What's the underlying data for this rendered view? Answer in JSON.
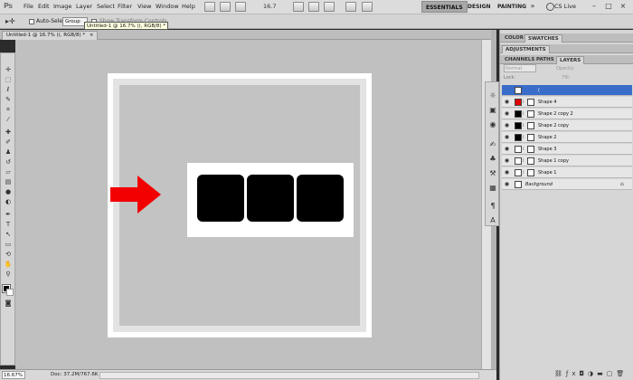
{
  "app": {
    "logo": "Ps",
    "menu": [
      "File",
      "Edit",
      "Image",
      "Layer",
      "Select",
      "Filter",
      "View",
      "Window",
      "Help"
    ],
    "zoom": "16.7",
    "workspaces": [
      "ESSENTIALS",
      "DESIGN",
      "PAINTING"
    ],
    "cs_live": "CS Live"
  },
  "options": {
    "auto_select_label": "Auto-Select:",
    "auto_select_value": "Group",
    "transform_label": "Show Transform Controls"
  },
  "tooltip": "Untitled-1 @ 16.7% ((, RGB/8) *",
  "document": {
    "tab_title": "Untitled-1 @ 16.7% ((, RGB/8) *",
    "tab_close": "×",
    "zoom_field": "16.67%",
    "doc_info": "Doc: 37.2M/767.6K"
  },
  "panels": {
    "top_tabs": [
      "COLOR",
      "SWATCHES"
    ],
    "adjustments": "ADJUSTMENTS",
    "layer_tabs": [
      "CHANNELS",
      "PATHS",
      "LAYERS"
    ],
    "blend_mode": "Normal",
    "opacity_label": "Opacity:",
    "fill_label": "Fill:",
    "lock_label": "Lock:"
  },
  "layers": [
    {
      "name": "(",
      "thumb": "#ffffff",
      "selected": true,
      "italic": false
    },
    {
      "name": "Shape 4",
      "thumb": "#e30000",
      "selected": false,
      "italic": false
    },
    {
      "name": "Shape 2 copy 2",
      "thumb": "#000000",
      "selected": false,
      "italic": false
    },
    {
      "name": "Shape 2 copy",
      "thumb": "#000000",
      "selected": false,
      "italic": false
    },
    {
      "name": "Shape 2",
      "thumb": "#000000",
      "selected": false,
      "italic": false
    },
    {
      "name": "Shape 3",
      "thumb": "#ffffff",
      "selected": false,
      "italic": false
    },
    {
      "name": "Shape 1 copy",
      "thumb": "#ffffff",
      "selected": false,
      "italic": false
    },
    {
      "name": "Shape 1",
      "thumb": "#ffffff",
      "selected": false,
      "italic": false
    },
    {
      "name": "Background",
      "thumb": "#ffffff",
      "selected": false,
      "italic": true
    }
  ],
  "colors": {
    "arrow": "#f20000",
    "selection": "#3a6cc9"
  }
}
